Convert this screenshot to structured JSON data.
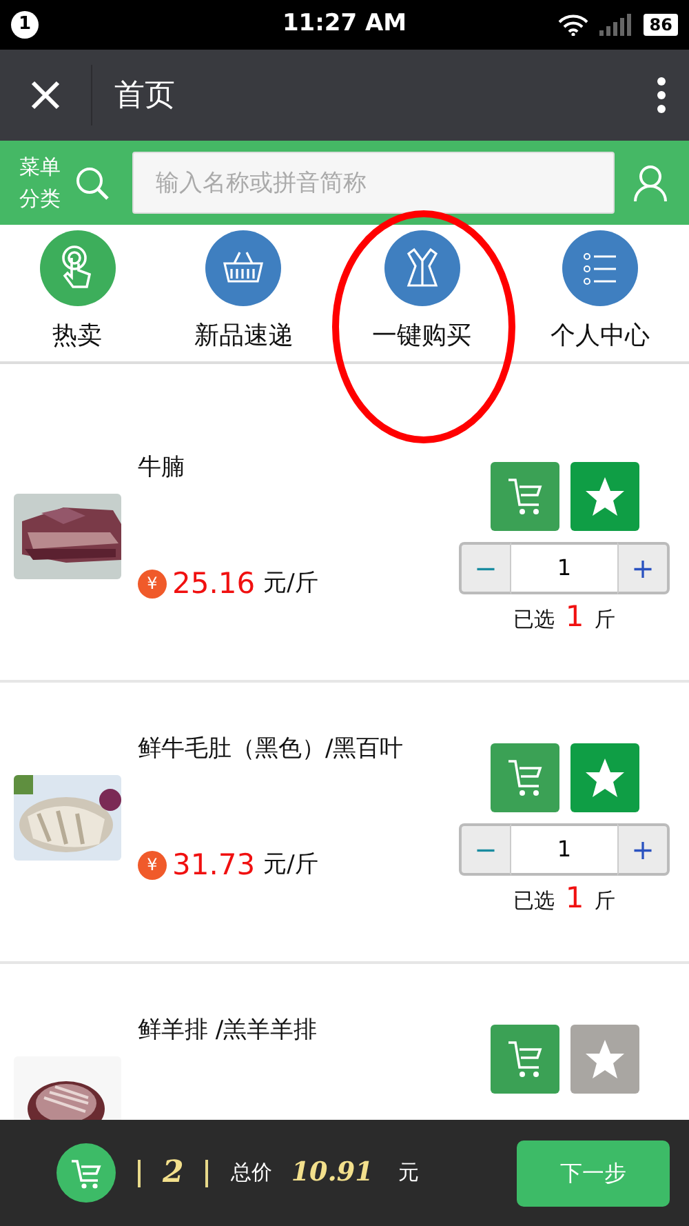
{
  "status_bar": {
    "notification_count": "1",
    "time": "11:27 AM",
    "battery": "86"
  },
  "header": {
    "title": "首页"
  },
  "search_bar": {
    "menu_label": "菜单分类",
    "placeholder": "输入名称或拼音简称"
  },
  "nav": [
    {
      "label": "热卖",
      "kind": "touch",
      "color": "#3dae5b",
      "circled": false
    },
    {
      "label": "新品速递",
      "kind": "basket",
      "color": "#3f7fc0",
      "circled": false
    },
    {
      "label": "一键购买",
      "kind": "gift",
      "color": "#3f7fc0",
      "circled": true
    },
    {
      "label": "个人中心",
      "kind": "list",
      "color": "#3f7fc0",
      "circled": false
    }
  ],
  "products": [
    {
      "name": "牛腩",
      "currency": "¥",
      "price": "25.16",
      "unit": "元/斤",
      "favorited": true,
      "minus": "−",
      "quantity": "1",
      "plus": "+",
      "selected_prefix": "已选",
      "selected_count": "1",
      "selected_unit": "斤"
    },
    {
      "name": "鲜牛毛肚（黑色）/黑百叶",
      "currency": "¥",
      "price": "31.73",
      "unit": "元/斤",
      "favorited": true,
      "minus": "−",
      "quantity": "1",
      "plus": "+",
      "selected_prefix": "已选",
      "selected_count": "1",
      "selected_unit": "斤"
    },
    {
      "name": "鲜羊排 /羔羊羊排",
      "favorited": false
    }
  ],
  "cart_bar": {
    "count": "2",
    "total_label": "总价",
    "total": "10.91",
    "currency": "元",
    "next_button": "下一步"
  }
}
